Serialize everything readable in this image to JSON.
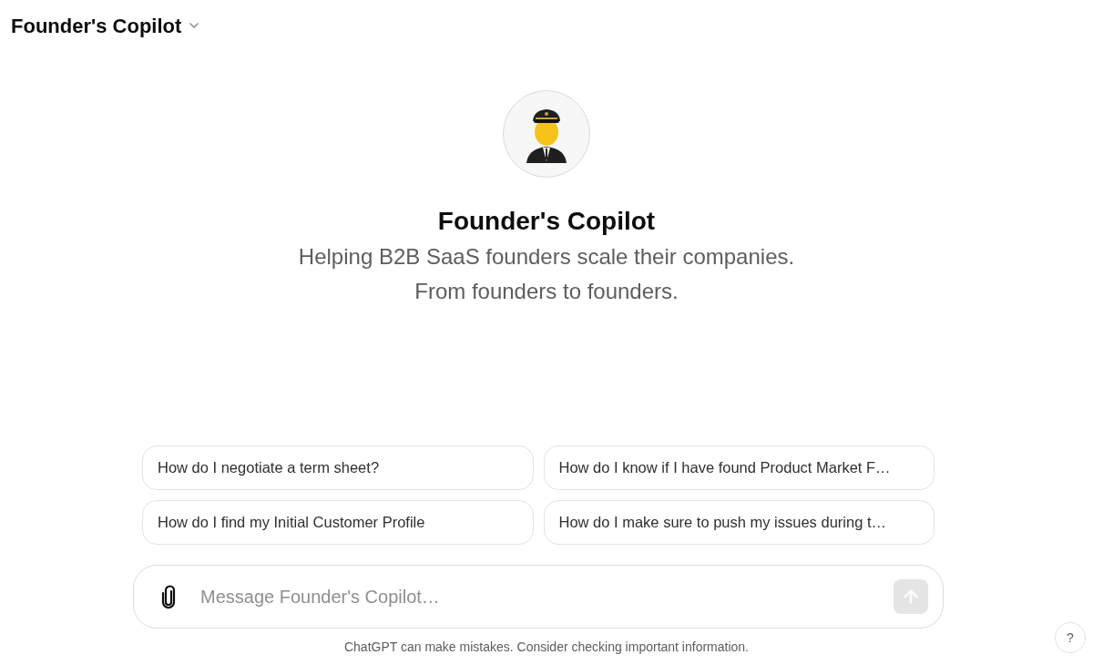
{
  "header": {
    "title": "Founder's Copilot"
  },
  "assistant": {
    "name": "Founder's Copilot",
    "description": "Helping B2B SaaS founders scale their companies. From founders to founders."
  },
  "suggestions": [
    "How do I negotiate a term sheet?",
    "How do I know if I have found Product Market F…",
    "How do I find my Initial Customer Profile",
    "How do I make sure to push my issues during t…"
  ],
  "composer": {
    "placeholder": "Message Founder's Copilot…",
    "send_disabled": true
  },
  "footer": "ChatGPT can make mistakes. Consider checking important information.",
  "help_button": "?"
}
